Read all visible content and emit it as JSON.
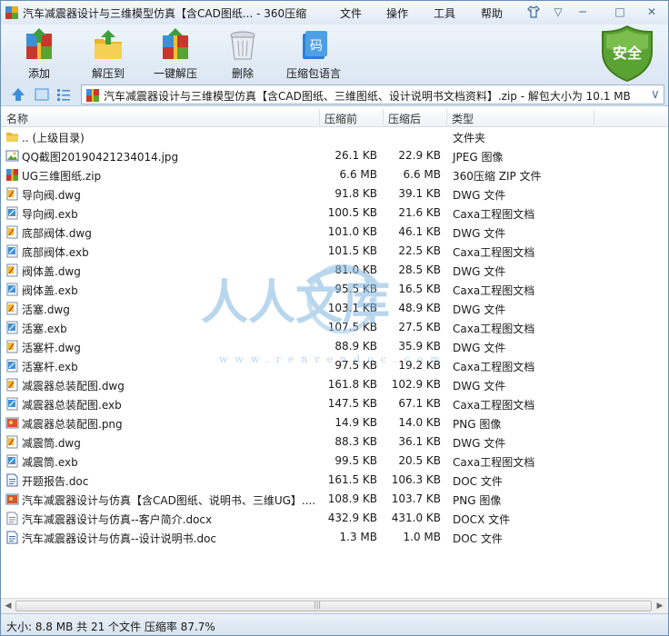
{
  "window": {
    "title": "汽车减震器设计与三维模型仿真【含CAD图纸... - 360压缩",
    "menus": [
      "文件",
      "操作",
      "工具",
      "帮助"
    ]
  },
  "toolbar": {
    "buttons": [
      {
        "label": "添加",
        "icon": "add-archive-icon"
      },
      {
        "label": "解压到",
        "icon": "extract-to-icon"
      },
      {
        "label": "一键解压",
        "icon": "one-click-extract-icon"
      },
      {
        "label": "删除",
        "icon": "trash-icon"
      },
      {
        "label": "压缩包语言",
        "icon": "archive-language-icon"
      }
    ],
    "badge": "安全",
    "badge_color": "#5aa232"
  },
  "address": {
    "path": "汽车减震器设计与三维模型仿真【含CAD图纸、三维图纸、设计说明书文档资料】.zip - 解包大小为 10.1 MB"
  },
  "columns": {
    "name": "名称",
    "size": "压缩前",
    "packed": "压缩后",
    "type": "类型"
  },
  "files": [
    {
      "name": ".. (上级目录)",
      "size": "",
      "packed": "",
      "type": "文件夹",
      "icon": "folder"
    },
    {
      "name": "QQ截图20190421234014.jpg",
      "size": "26.1 KB",
      "packed": "22.9 KB",
      "type": "JPEG 图像",
      "icon": "jpg"
    },
    {
      "name": "UG三维图纸.zip",
      "size": "6.6 MB",
      "packed": "6.6 MB",
      "type": "360压缩 ZIP 文件",
      "icon": "zip"
    },
    {
      "name": "导向阀.dwg",
      "size": "91.8 KB",
      "packed": "39.1 KB",
      "type": "DWG 文件",
      "icon": "dwg"
    },
    {
      "name": "导向阀.exb",
      "size": "100.5 KB",
      "packed": "21.6 KB",
      "type": "Caxa工程图文档",
      "icon": "exb"
    },
    {
      "name": "底部阀体.dwg",
      "size": "101.0 KB",
      "packed": "46.1 KB",
      "type": "DWG 文件",
      "icon": "dwg"
    },
    {
      "name": "底部阀体.exb",
      "size": "101.5 KB",
      "packed": "22.5 KB",
      "type": "Caxa工程图文档",
      "icon": "exb"
    },
    {
      "name": "阀体盖.dwg",
      "size": "81.0 KB",
      "packed": "28.5 KB",
      "type": "DWG 文件",
      "icon": "dwg"
    },
    {
      "name": "阀体盖.exb",
      "size": "95.5 KB",
      "packed": "16.5 KB",
      "type": "Caxa工程图文档",
      "icon": "exb"
    },
    {
      "name": "活塞.dwg",
      "size": "103.1 KB",
      "packed": "48.9 KB",
      "type": "DWG 文件",
      "icon": "dwg"
    },
    {
      "name": "活塞.exb",
      "size": "107.5 KB",
      "packed": "27.5 KB",
      "type": "Caxa工程图文档",
      "icon": "exb"
    },
    {
      "name": "活塞杆.dwg",
      "size": "88.9 KB",
      "packed": "35.9 KB",
      "type": "DWG 文件",
      "icon": "dwg"
    },
    {
      "name": "活塞杆.exb",
      "size": "97.5 KB",
      "packed": "19.2 KB",
      "type": "Caxa工程图文档",
      "icon": "exb"
    },
    {
      "name": "减震器总装配图.dwg",
      "size": "161.8 KB",
      "packed": "102.9 KB",
      "type": "DWG 文件",
      "icon": "dwg"
    },
    {
      "name": "减震器总装配图.exb",
      "size": "147.5 KB",
      "packed": "67.1 KB",
      "type": "Caxa工程图文档",
      "icon": "exb"
    },
    {
      "name": "减震器总装配图.png",
      "size": "14.9 KB",
      "packed": "14.0 KB",
      "type": "PNG 图像",
      "icon": "png"
    },
    {
      "name": "减震筒.dwg",
      "size": "88.3 KB",
      "packed": "36.1 KB",
      "type": "DWG 文件",
      "icon": "dwg"
    },
    {
      "name": "减震筒.exb",
      "size": "99.5 KB",
      "packed": "20.5 KB",
      "type": "Caxa工程图文档",
      "icon": "exb"
    },
    {
      "name": "开题报告.doc",
      "size": "161.5 KB",
      "packed": "106.3 KB",
      "type": "DOC 文件",
      "icon": "doc"
    },
    {
      "name": "汽车减震器设计与仿真【含CAD图纸、说明书、三维UG】....",
      "size": "108.9 KB",
      "packed": "103.7 KB",
      "type": "PNG 图像",
      "icon": "png"
    },
    {
      "name": "汽车减震器设计与仿真--客户简介.docx",
      "size": "432.9 KB",
      "packed": "431.0 KB",
      "type": "DOCX 文件",
      "icon": "docx"
    },
    {
      "name": "汽车减震器设计与仿真--设计说明书.doc",
      "size": "1.3 MB",
      "packed": "1.0 MB",
      "type": "DOC 文件",
      "icon": "doc"
    }
  ],
  "watermark": {
    "text": "人人文库",
    "url": "www.renrendoc.com"
  },
  "status": {
    "text": "大小: 8.8 MB 共 21 个文件 压缩率 87.7%"
  }
}
